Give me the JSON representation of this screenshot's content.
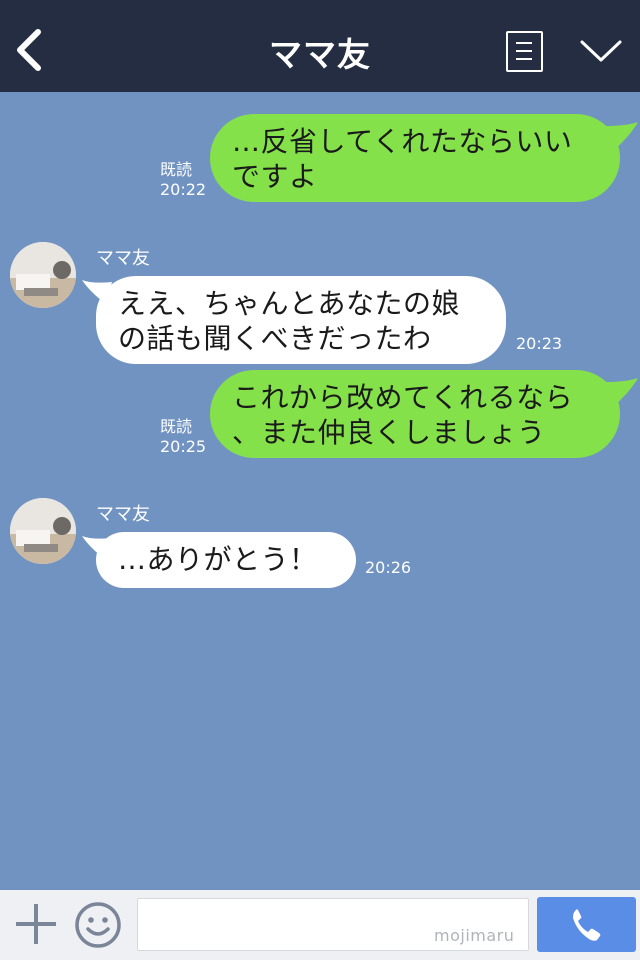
{
  "header": {
    "title": "ママ友",
    "back_icon": "chevron-left-icon",
    "menu_icon": "list-icon",
    "collapse_icon": "chevron-down-icon",
    "background": "#242d42"
  },
  "chat": {
    "background": "#7193c2",
    "messages": [
      {
        "direction": "outgoing",
        "text": "…反省してくれたならいい\nですよ",
        "read_label": "既読",
        "time": "20:22"
      },
      {
        "direction": "incoming",
        "sender": "ママ友",
        "text": "ええ、ちゃんとあなたの娘\nの話も聞くべきだったわ",
        "time": "20:23"
      },
      {
        "direction": "outgoing",
        "text": "これから改めてくれるなら\n、また仲良くしましょう",
        "read_label": "既読",
        "time": "20:25"
      },
      {
        "direction": "incoming",
        "sender": "ママ友",
        "text": "…ありがとう！",
        "time": "20:26"
      }
    ],
    "outgoing_bubble_color": "#85e14a",
    "incoming_bubble_color": "#ffffff"
  },
  "footer": {
    "plus_icon": "plus-icon",
    "emoji_icon": "smiley-icon",
    "input_value": "",
    "watermark": "mojimaru",
    "call_icon": "phone-icon",
    "call_button_color": "#5a8de6"
  }
}
